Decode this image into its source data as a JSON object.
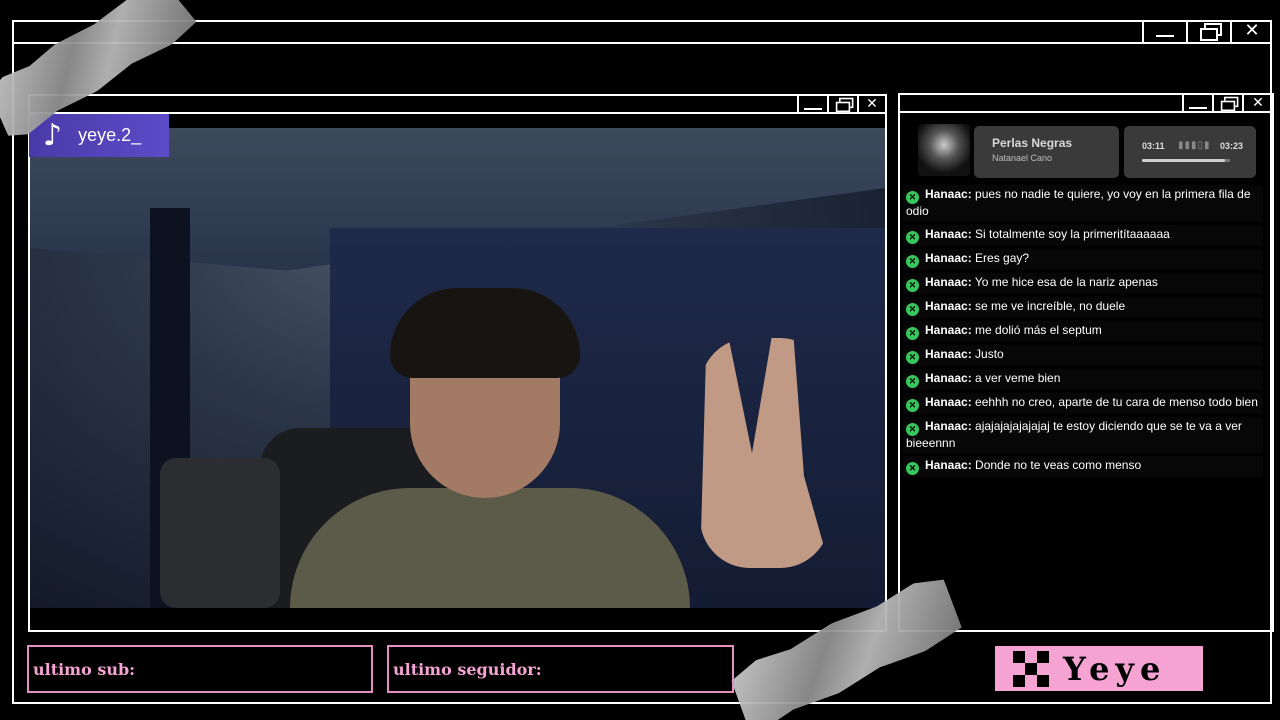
{
  "stream": {
    "platform_icon": "tiktok-icon",
    "username": "yeye.2_"
  },
  "now_playing": {
    "title": "Perlas Negras",
    "artist": "Natanael Cano",
    "time_elapsed": "03:11",
    "time_total": "03:23",
    "progress": 0.94
  },
  "chat": {
    "messages": [
      {
        "user": "Hanaac:",
        "text": "pues no nadie te quiere, yo voy en la primera fila de odio"
      },
      {
        "user": "Hanaac:",
        "text": "Si totalmente soy la primeritítaaaaaa"
      },
      {
        "user": "Hanaac:",
        "text": "Eres gay?"
      },
      {
        "user": "Hanaac:",
        "text": "Yo me hice esa de la nariz apenas"
      },
      {
        "user": "Hanaac:",
        "text": "se me ve increíble, no duele"
      },
      {
        "user": "Hanaac:",
        "text": "me dolió más el septum"
      },
      {
        "user": "Hanaac:",
        "text": "Justo"
      },
      {
        "user": "Hanaac:",
        "text": "a ver veme bien"
      },
      {
        "user": "Hanaac:",
        "text": "eehhh no creo, aparte de tu cara de menso todo bien"
      },
      {
        "user": "Hanaac:",
        "text": "ajajajajajajajaj te estoy diciendo que se te va a ver bieeennn"
      },
      {
        "user": "Hanaac:",
        "text": "Donde no te veas como menso"
      }
    ]
  },
  "footer": {
    "last_sub_label": "ultimo sub:",
    "last_follower_label": "ultimo seguidor:",
    "brand_name": "Yeye"
  },
  "colors": {
    "accent_pink": "#f4a3d3",
    "chat_badge_green": "#36c85e",
    "tiktok_badge": "#5d4bc8"
  }
}
